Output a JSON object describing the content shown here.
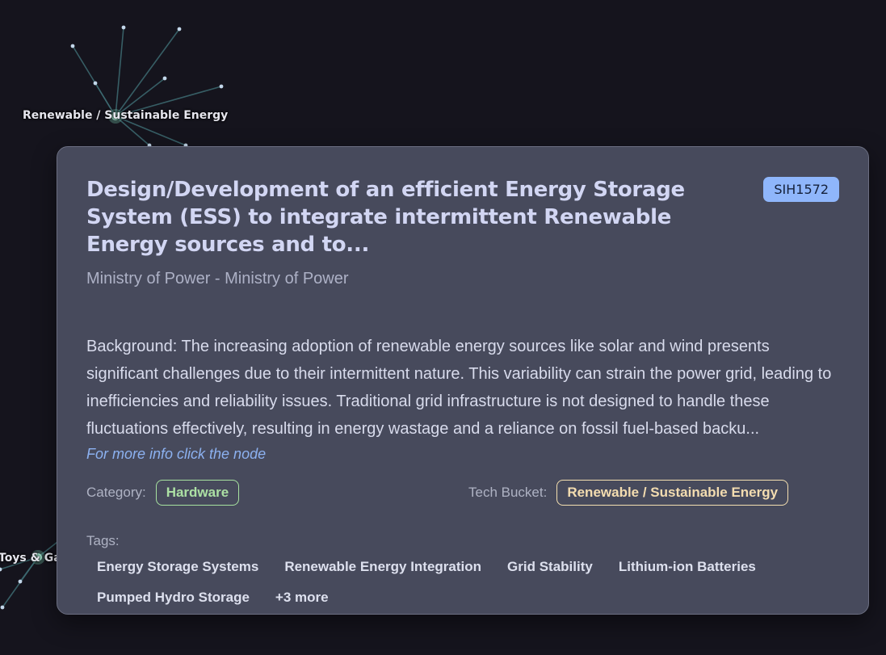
{
  "graph": {
    "labels": {
      "renewable": "Renewable / Sustainable Energy",
      "toys": "Toys & Games"
    }
  },
  "card": {
    "title": "Design/Development of an efficient Energy Storage System (ESS) to integrate intermittent Renewable Energy sources and to...",
    "id_badge": "SIH1572",
    "ministry": "Ministry of Power - Ministry of Power",
    "description": "Background: The increasing adoption of renewable energy sources like solar and wind presents significant challenges due to their intermittent nature. This variability can strain the power grid, leading to inefficiencies and reliability issues. Traditional grid infrastructure is not designed to handle these fluctuations effectively, resulting in energy wastage and a reliance on fossil fuel-based backu...",
    "more_info": "For more info click the node",
    "category_label": "Category:",
    "category": "Hardware",
    "tech_bucket_label": "Tech Bucket:",
    "tech_bucket": "Renewable / Sustainable Energy",
    "tags_label": "Tags:",
    "tags": [
      "Energy Storage Systems",
      "Renewable Energy Integration",
      "Grid Stability",
      "Lithium-ion Batteries",
      "Pumped Hydro Storage",
      "+3 more"
    ]
  },
  "colors": {
    "background": "#15141d",
    "card": "#474a5c",
    "id_badge": "#8fb6fb",
    "category_pill": "#a7e2a0",
    "tech_bucket_pill": "#f4dfb0",
    "link": "#8cb1f0",
    "graph_edge": "#3d6b72",
    "graph_node": "#c3d7ea"
  }
}
